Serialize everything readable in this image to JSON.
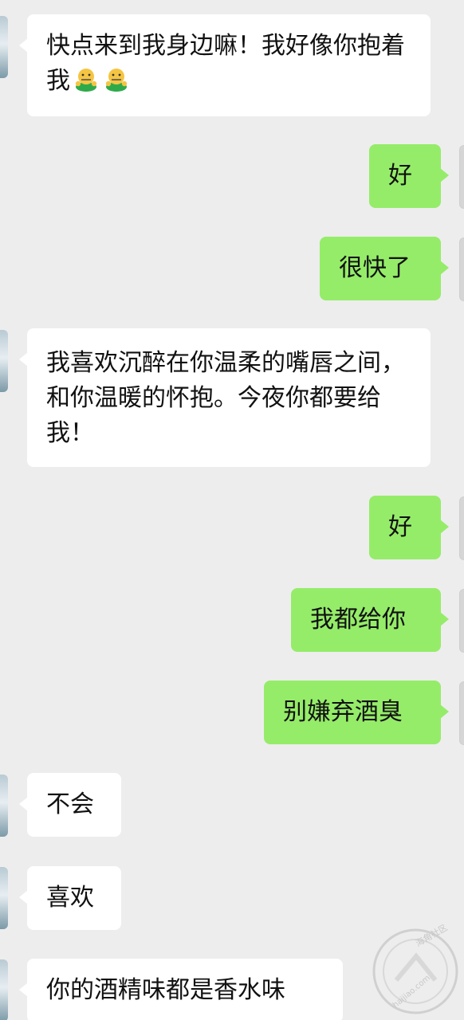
{
  "messages": [
    {
      "side": "left",
      "text": "快点来到我身边嘛！我好像你抱着我",
      "emoji": [
        "zipper-mouth-hug-icon",
        "zipper-mouth-hug-icon"
      ]
    },
    {
      "side": "right",
      "text": "好"
    },
    {
      "side": "right",
      "text": "很快了"
    },
    {
      "side": "left",
      "text": "我喜欢沉醉在你温柔的嘴唇之间，和你温暖的怀抱。今夜你都要给我！"
    },
    {
      "side": "right",
      "text": "好"
    },
    {
      "side": "right",
      "text": "我都给你"
    },
    {
      "side": "right",
      "text": "别嫌弃酒臭"
    },
    {
      "side": "left",
      "text": "不会"
    },
    {
      "side": "left",
      "text": "喜欢"
    },
    {
      "side": "left",
      "text": "你的酒精味都是香水味"
    }
  ],
  "watermark": {
    "line1": "海角社区",
    "line2": "haijiao.com"
  },
  "colors": {
    "background": "#ededed",
    "incoming_bubble": "#ffffff",
    "outgoing_bubble": "#95ec69",
    "text": "#111111"
  }
}
